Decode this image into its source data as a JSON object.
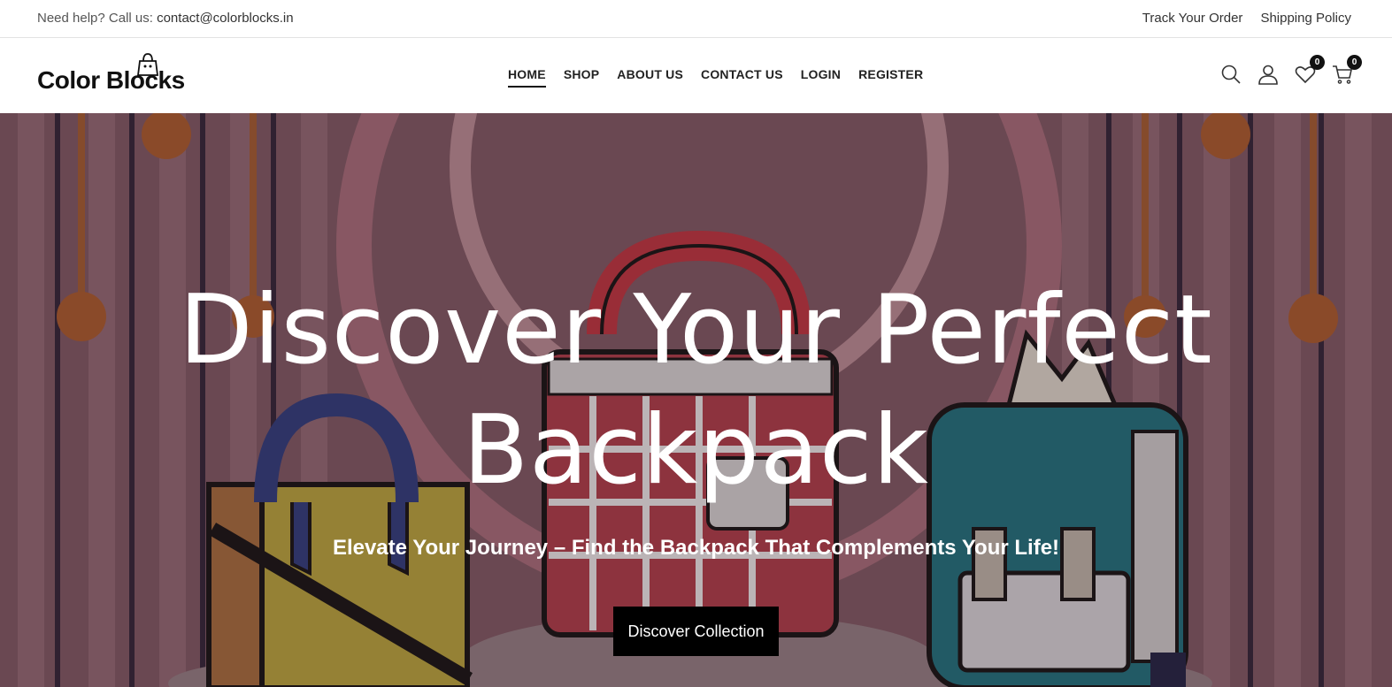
{
  "topbar": {
    "help_prefix": "Need help? Call us: ",
    "help_email": "contact@colorblocks.in",
    "links": [
      "Track Your Order",
      "Shipping Policy"
    ]
  },
  "header": {
    "logo_text": "Color Blocks",
    "nav": [
      "HOME",
      "SHOP",
      "ABOUT US",
      "CONTACT US",
      "LOGIN",
      "REGISTER"
    ],
    "wishlist_count": "0",
    "cart_count": "0"
  },
  "hero": {
    "headline_line1": "Discover Your Perfect",
    "headline_line2": "Backpack",
    "subheadline": "Elevate Your Journey – Find the Backpack That Complements Your Life!",
    "cta_label": "Discover Collection"
  },
  "colors": {
    "accent": "#000000",
    "hero_overlay": "#6a4a52"
  }
}
